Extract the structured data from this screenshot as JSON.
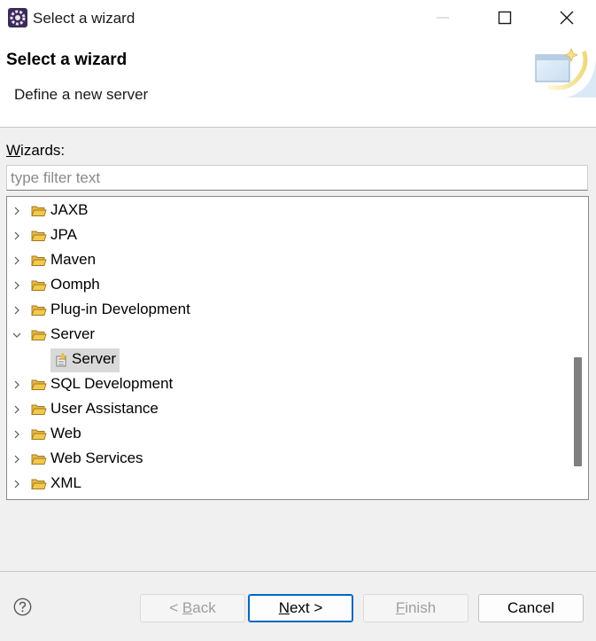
{
  "window": {
    "title": "Select a wizard",
    "icon": "eclipse-gear-icon",
    "controls": [
      "minimize-icon",
      "maximize-icon",
      "close-icon"
    ]
  },
  "header": {
    "title": "Select a wizard",
    "description": "Define a new server",
    "graphic": "new-wizard-banner-icon"
  },
  "wizards": {
    "label_mnemonic": "W",
    "label_rest": "izards:",
    "filter_placeholder": "type filter text",
    "filter_value": ""
  },
  "tree": {
    "items": [
      {
        "label": "JAXB",
        "expanded": false
      },
      {
        "label": "JPA",
        "expanded": false
      },
      {
        "label": "Maven",
        "expanded": false
      },
      {
        "label": "Oomph",
        "expanded": false
      },
      {
        "label": "Plug-in Development",
        "expanded": false
      },
      {
        "label": "Server",
        "expanded": true
      },
      {
        "label": "Server",
        "child": true,
        "selected": true
      },
      {
        "label": "SQL Development",
        "expanded": false
      },
      {
        "label": "User Assistance",
        "expanded": false
      },
      {
        "label": "Web",
        "expanded": false
      },
      {
        "label": "Web Services",
        "expanded": false
      },
      {
        "label": "XML",
        "expanded": false
      }
    ],
    "scroll_position": 0.72
  },
  "footer": {
    "help_icon": "help-icon",
    "back": {
      "prefix": "< ",
      "mnemonic": "B",
      "rest": "ack",
      "enabled": false
    },
    "next": {
      "mnemonic": "N",
      "rest": "ext >",
      "enabled": true,
      "default": true
    },
    "finish": {
      "mnemonic": "F",
      "rest": "inish",
      "enabled": false
    },
    "cancel": {
      "label": "Cancel",
      "enabled": true
    }
  },
  "colors": {
    "accent": "#0067c0",
    "folder": "#f2c94c",
    "background": "#f0f0f0",
    "disabled_text": "#9e9e9e"
  }
}
